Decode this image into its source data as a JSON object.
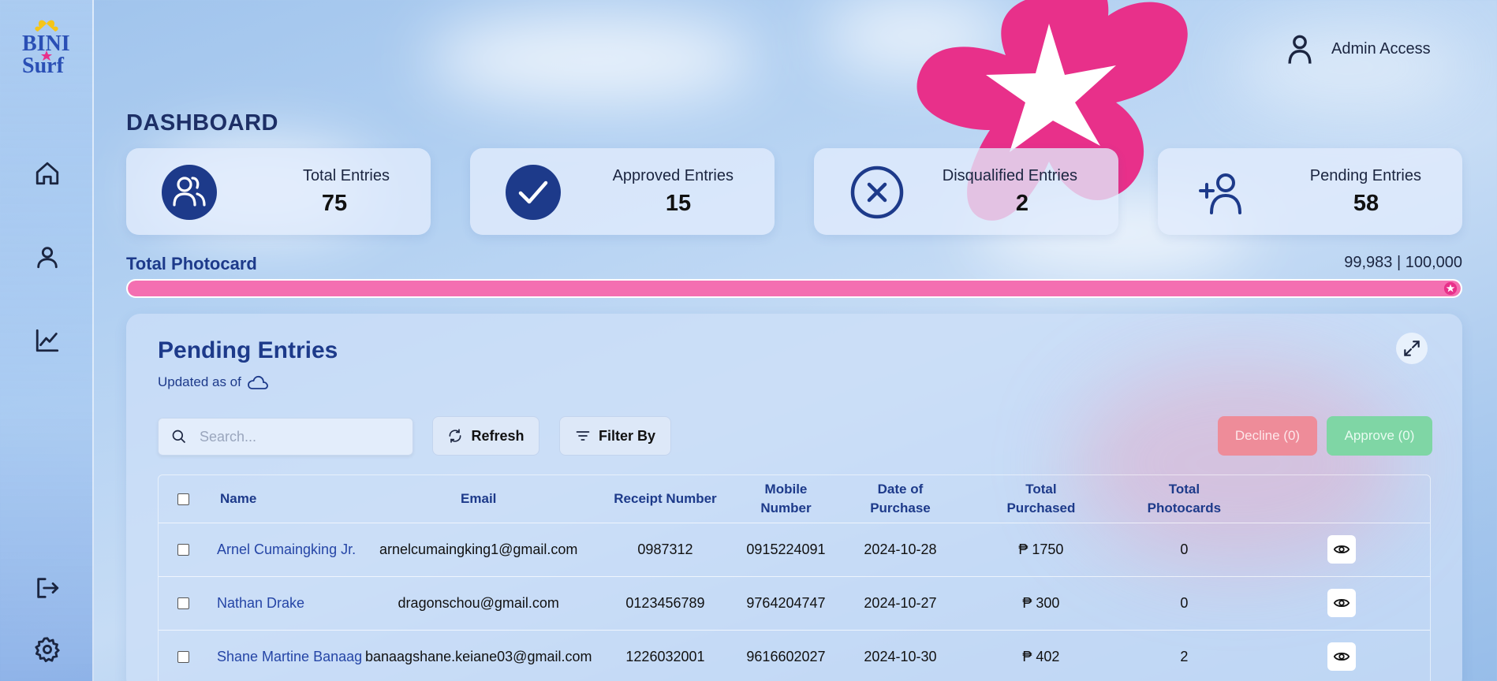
{
  "header": {
    "user_label": "Admin Access"
  },
  "sidebar": {
    "logo_text_top": "BINI",
    "logo_text_bottom": "Surf",
    "items": [
      {
        "icon": "home-icon"
      },
      {
        "icon": "user-icon"
      },
      {
        "icon": "chart-line-icon"
      },
      {
        "icon": "logout-icon"
      },
      {
        "icon": "gear-icon"
      }
    ]
  },
  "page": {
    "title": "DASHBOARD"
  },
  "stats": [
    {
      "label": "Total Entries",
      "value": "75",
      "icon": "users-icon"
    },
    {
      "label": "Approved Entries",
      "value": "15",
      "icon": "check-circle-icon"
    },
    {
      "label": "Disqualified Entries",
      "value": "2",
      "icon": "x-circle-icon"
    },
    {
      "label": "Pending Entries",
      "value": "58",
      "icon": "user-plus-icon"
    }
  ],
  "photocard": {
    "label": "Total Photocard",
    "count_text": "99,983 | 100,000",
    "progress_fraction": 0.99983,
    "color": "#f46fb1"
  },
  "pending": {
    "title": "Pending Entries",
    "updated_label": "Updated as of",
    "search_placeholder": "Search...",
    "refresh_label": "Refresh",
    "filter_label": "Filter By",
    "decline_label": "Decline (0)",
    "approve_label": "Approve (0)",
    "columns": {
      "name": "Name",
      "email": "Email",
      "receipt": "Receipt Number",
      "mobile": "Mobile Number",
      "date": "Date of Purchase",
      "total_purchased": "Total Purchased",
      "total_photocards": "Total Photocards"
    },
    "rows": [
      {
        "name": "Arnel Cumaingking Jr.",
        "email": "arnelcumaingking1@gmail.com",
        "receipt": "0987312",
        "mobile": "0915224091",
        "date": "2024-10-28",
        "total_purchased": "₱ 1750",
        "total_photocards": "0"
      },
      {
        "name": "Nathan Drake",
        "email": "dragonschou@gmail.com",
        "receipt": "0123456789",
        "mobile": "9764204747",
        "date": "2024-10-27",
        "total_purchased": "₱ 300",
        "total_photocards": "0"
      },
      {
        "name": "Shane Martine Banaag",
        "email": "banaagshane.keiane03@gmail.com",
        "receipt": "1226032001",
        "mobile": "9616602027",
        "date": "2024-10-30",
        "total_purchased": "₱ 402",
        "total_photocards": "2"
      }
    ]
  },
  "colors": {
    "accent_blue": "#1d3a8a",
    "decline": "#ee8c99",
    "approve": "#7fd6a5",
    "flower": "#e8308a"
  }
}
